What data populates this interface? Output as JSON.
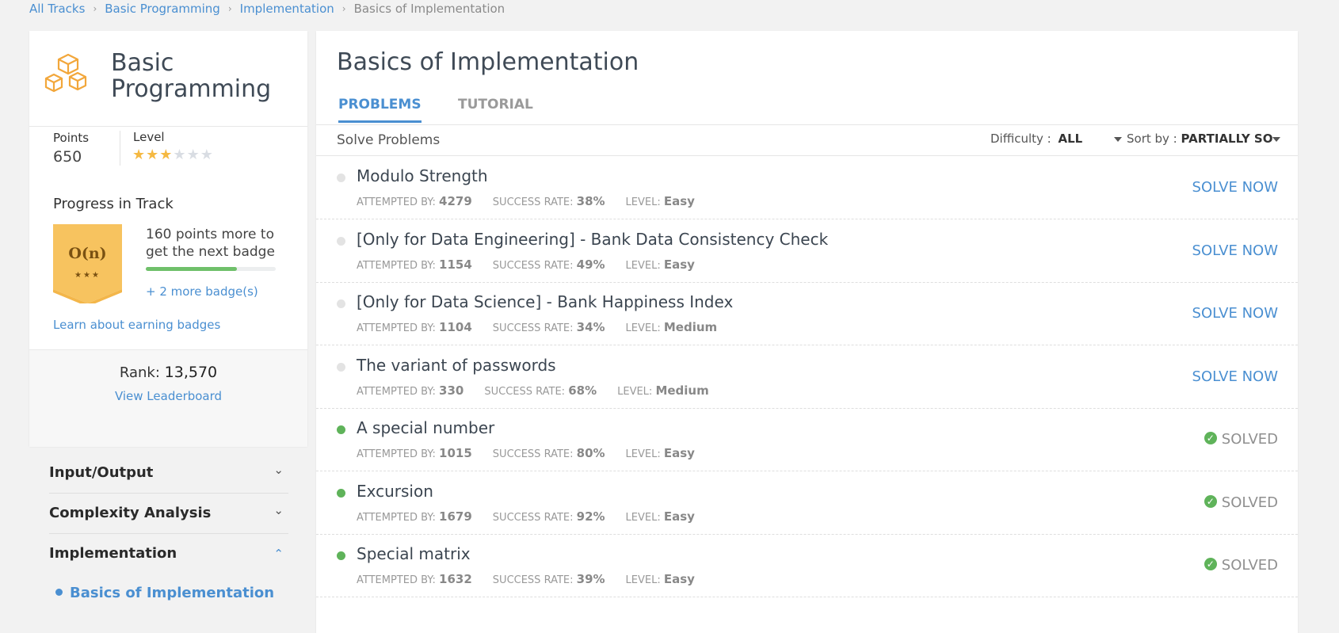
{
  "breadcrumb": [
    "All Tracks",
    "Basic Programming",
    "Implementation",
    "Basics of Implementation"
  ],
  "track": {
    "title_line1": "Basic",
    "title_line2": "Programming",
    "points_label": "Points",
    "points_value": "650",
    "level_label": "Level",
    "level_stars_filled": 3,
    "level_stars_total": 6,
    "progress_title": "Progress in Track",
    "badge_text": "O(n)",
    "badge_stars": "★★★",
    "progress_text": "160 points more to get the next badge",
    "progress_fraction": 0.7,
    "more_badges": "+ 2 more badge(s)",
    "learn_link": "Learn about earning badges",
    "rank_label": "Rank:",
    "rank_value": "13,570",
    "leaderboard_link": "View Leaderboard"
  },
  "accordion": [
    {
      "label": "Input/Output",
      "expanded": false
    },
    {
      "label": "Complexity Analysis",
      "expanded": false
    },
    {
      "label": "Implementation",
      "expanded": true
    }
  ],
  "accordion_sub": "Basics of Implementation",
  "main": {
    "title": "Basics of Implementation",
    "tab_problems": "PROBLEMS",
    "tab_tutorial": "TUTORIAL",
    "solve_title": "Solve Problems",
    "difficulty_label": "Difficulty :",
    "difficulty_value": "ALL",
    "sort_label": "Sort by :",
    "sort_value": "PARTIALLY SOLVED"
  },
  "meta_labels": {
    "attempted": "ATTEMPTED BY:",
    "success": "SUCCESS RATE:",
    "level": "LEVEL:"
  },
  "problems": [
    {
      "name": "Modulo Strength",
      "attempted": "4279",
      "success": "38%",
      "level": "Easy",
      "status": "SOLVE NOW",
      "solved": false
    },
    {
      "name": "[Only for Data Engineering] - Bank Data Consistency Check",
      "attempted": "1154",
      "success": "49%",
      "level": "Easy",
      "status": "SOLVE NOW",
      "solved": false
    },
    {
      "name": "[Only for Data Science] - Bank Happiness Index",
      "attempted": "1104",
      "success": "34%",
      "level": "Medium",
      "status": "SOLVE NOW",
      "solved": false
    },
    {
      "name": "The variant of passwords",
      "attempted": "330",
      "success": "68%",
      "level": "Medium",
      "status": "SOLVE NOW",
      "solved": false
    },
    {
      "name": "A special number",
      "attempted": "1015",
      "success": "80%",
      "level": "Easy",
      "status": "SOLVED",
      "solved": true
    },
    {
      "name": "Excursion",
      "attempted": "1679",
      "success": "92%",
      "level": "Easy",
      "status": "SOLVED",
      "solved": true
    },
    {
      "name": "Special matrix",
      "attempted": "1632",
      "success": "39%",
      "level": "Easy",
      "status": "SOLVED",
      "solved": true
    }
  ],
  "colors": {
    "accent": "#4a8fd1",
    "solved_dot": "#5fb35a",
    "unsolved_dot": "#e3e3e3",
    "star": "#f5b942",
    "badge": "#f7c35f"
  }
}
